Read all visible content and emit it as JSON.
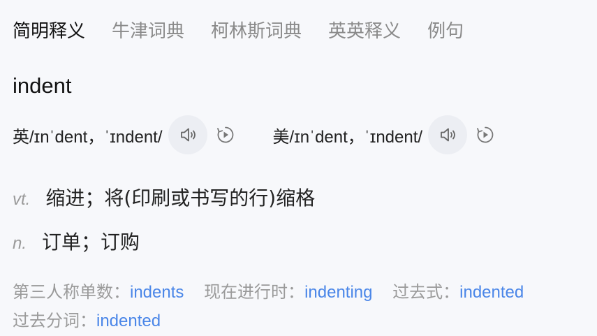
{
  "tabs": [
    {
      "label": "简明释义",
      "active": true
    },
    {
      "label": "牛津词典",
      "active": false
    },
    {
      "label": "柯林斯词典",
      "active": false
    },
    {
      "label": "英英释义",
      "active": false
    },
    {
      "label": "例句",
      "active": false
    }
  ],
  "headword": "indent",
  "pronunciations": {
    "uk": {
      "text": "英/ɪnˈdent，ˈɪndent/"
    },
    "us": {
      "text": "美/ɪnˈdent，ˈɪndent/"
    }
  },
  "definitions": [
    {
      "pos": "vt.",
      "meaning": "缩进；将(印刷或书写的行)缩格"
    },
    {
      "pos": "n.",
      "meaning": "订单；订购"
    }
  ],
  "forms": [
    {
      "label": "第三人称单数：",
      "value": "indents"
    },
    {
      "label": "现在进行时：",
      "value": "indenting"
    },
    {
      "label": "过去式：",
      "value": "indented"
    },
    {
      "label": "过去分词：",
      "value": "indented"
    }
  ],
  "icons": {
    "speaker": "speaker-icon",
    "replay": "replay-icon"
  },
  "colors": {
    "link": "#4a86e8",
    "muted": "#9a9a9a",
    "active_underline": "#cfe0ff",
    "audio_button_bg": "#eceef3"
  }
}
